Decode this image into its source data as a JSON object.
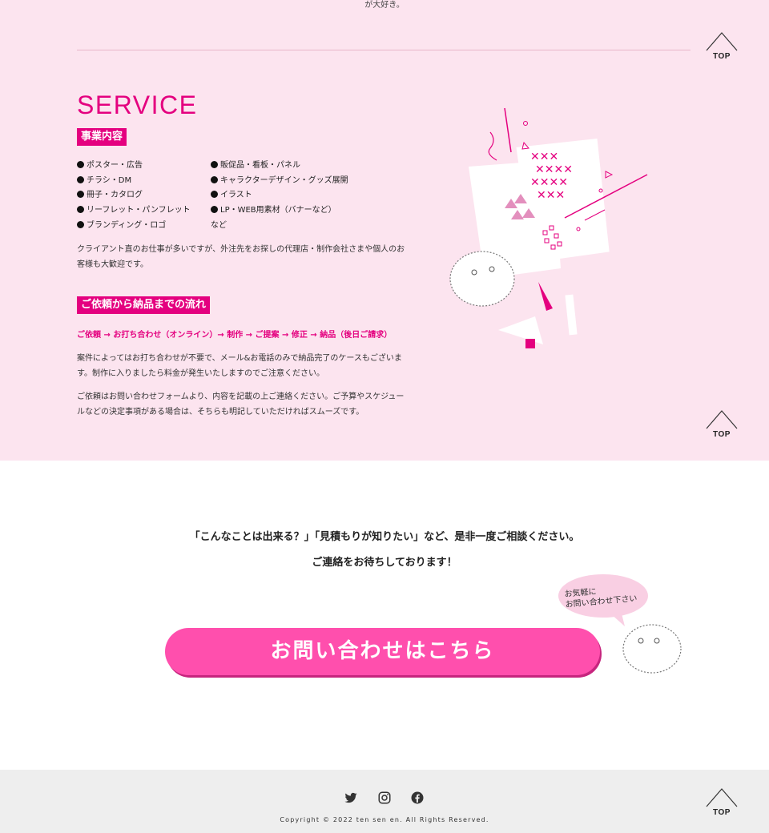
{
  "top_fragment": "が大好き。",
  "top_button": {
    "label": "TOP"
  },
  "service": {
    "title": "SERVICE",
    "business_heading": "事業内容",
    "services_left": [
      "ポスター・広告",
      "チラシ・DM",
      "冊子・カタログ",
      "リーフレット・パンフレット",
      "ブランディング・ロゴ"
    ],
    "services_right": [
      "販促品・看板・パネル",
      "キャラクターデザイン・グッズ展開",
      "イラスト",
      "LP・WEB用素材（バナーなど）"
    ],
    "services_right_extra": "など",
    "client_text": "クライアント直のお仕事が多いですが、外注先をお探しの代理店・制作会社さまや個人のお客様も大歓迎です。",
    "flow_heading": "ご依頼から納品までの流れ",
    "flow_steps": "ご依頼 → お打ち合わせ（オンライン）→ 制作 → ご提案 → 修正 → 納品（後日ご請求）",
    "case_text": "案件によってはお打ち合わせが不要で、メール&お電話のみで納品完了のケースもございます。制作に入りましたら料金が発生いたしますのでご注意ください。",
    "contact_text": "ご依頼はお問い合わせフォームより、内容を記載の上ご連絡ください。ご予算やスケジュールなどの決定事項がある場合は、そちらも明記していただければスムーズです。"
  },
  "cta": {
    "line1": "「こんなことは出来る？」「見積もりが知りたい」など、是非一度ご相談ください。",
    "line2": "ご連絡をお待ちしております！",
    "bubble_line1": "お気軽に",
    "bubble_line2": "お問い合わせ下さい",
    "button_label": "お問い合わせはこちら"
  },
  "footer": {
    "social": [
      "twitter-icon",
      "instagram-icon",
      "facebook-icon"
    ],
    "copyright": "Copyright © 2022 ten sen en. All Rights Reserved."
  },
  "colors": {
    "accent": "#e4007f",
    "button": "#ff4fad",
    "section_bg": "#fce4ef",
    "footer_bg": "#eeeeee"
  }
}
